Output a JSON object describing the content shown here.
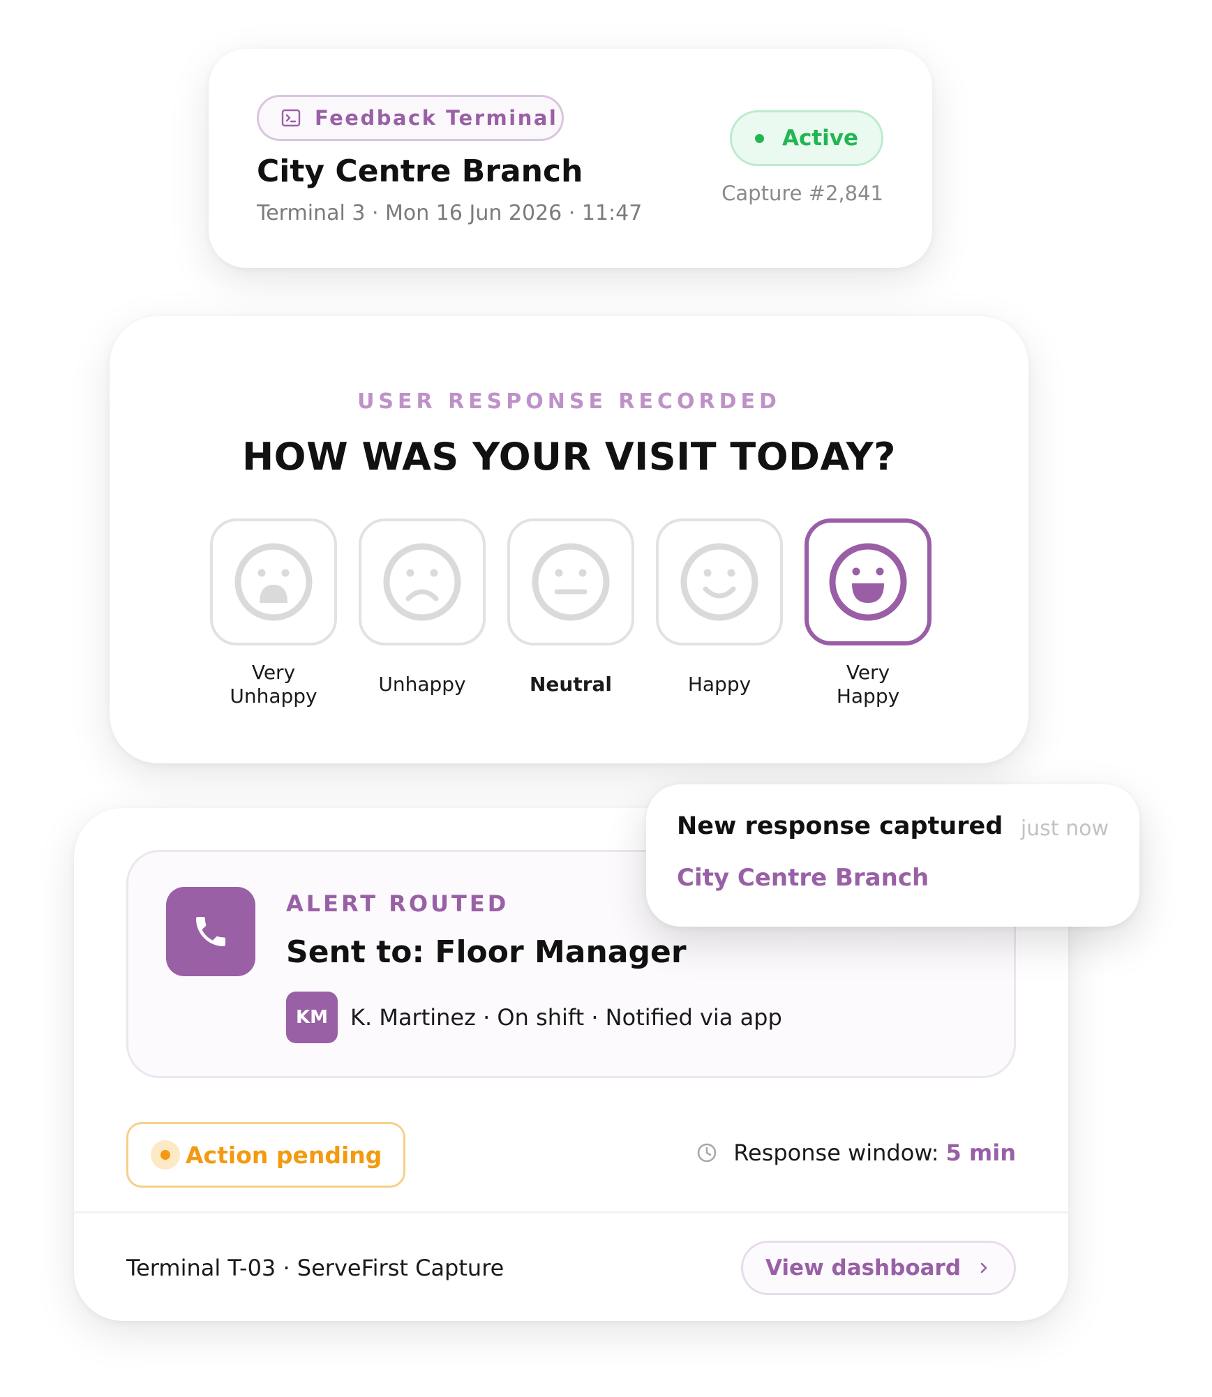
{
  "terminal_card": {
    "chip_label": "Feedback Terminal",
    "chip_icon": "terminal-icon",
    "branch_name": "City Centre Branch",
    "meta": "Terminal 3 · Mon 16 Jun 2026 · 11:47",
    "status": "Active",
    "capture": "Capture #2,841"
  },
  "survey": {
    "eyebrow": "USER RESPONSE RECORDED",
    "question": "HOW WAS YOUR VISIT TODAY?",
    "options": [
      {
        "label": "Very\nUnhappy",
        "icon": "very-unhappy-face-icon"
      },
      {
        "label": "Unhappy",
        "icon": "unhappy-face-icon"
      },
      {
        "label": "Neutral",
        "icon": "neutral-face-icon"
      },
      {
        "label": "Happy",
        "icon": "happy-face-icon"
      },
      {
        "label": "Very\nHappy",
        "icon": "very-happy-face-icon"
      }
    ],
    "selected_option": "Very Happy"
  },
  "alert": {
    "eyebrow": "ALERT ROUTED",
    "title": "Sent to: Floor Manager",
    "avatar_initials": "KM",
    "assignee": "K. Martinez · On shift · Notified via app",
    "icon": "phone-icon"
  },
  "status_row": {
    "pending": "Action pending",
    "window_label": "Response window:",
    "window_value": "5 min",
    "window_icon": "clock-icon"
  },
  "footer": {
    "terminal_text": "Terminal T-03 · ServeFirst Capture",
    "button_label": "View dashboard"
  },
  "toast": {
    "title": "New response captured",
    "time": "just now",
    "branch": "City Centre Branch"
  },
  "colors": {
    "accent": "#9960a6",
    "accent_light": "#be91c8",
    "success": "#22b653",
    "warning": "#f39a10",
    "neutral_border": "#e2e2e2"
  }
}
